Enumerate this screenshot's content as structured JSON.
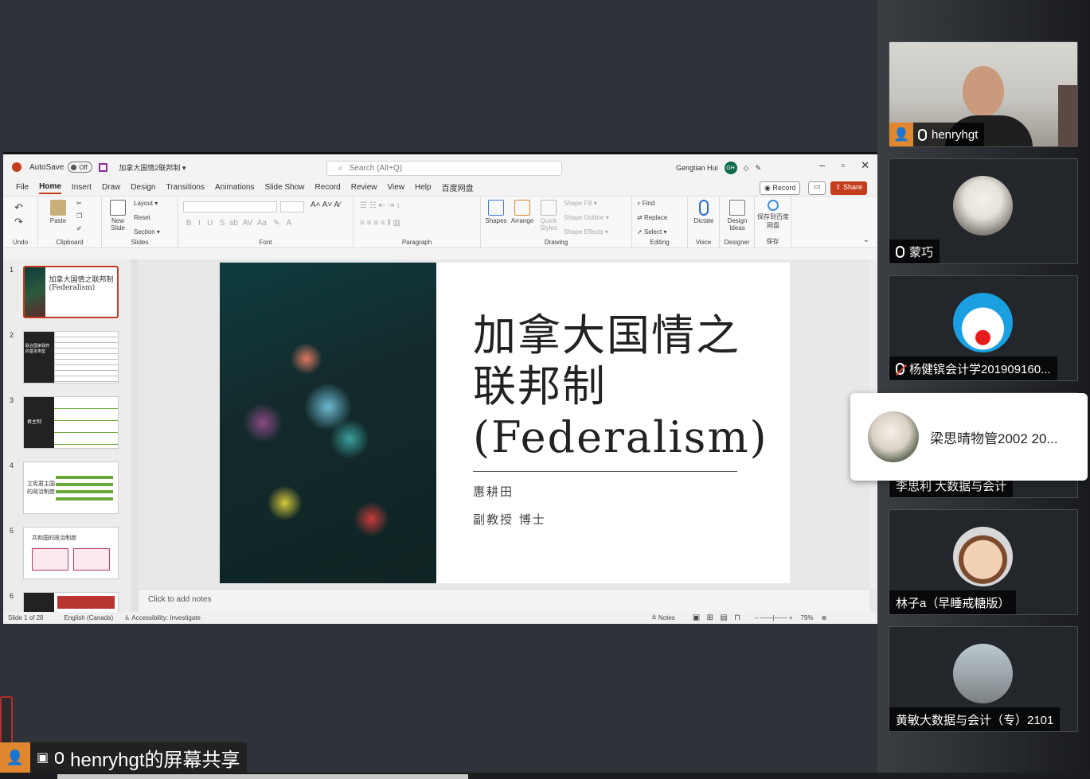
{
  "ppt": {
    "autosave_label": "AutoSave",
    "toggle_label": "Off",
    "doc_title": "加拿大国情2联邦制 ▾",
    "search_placeholder": "Search (Alt+Q)",
    "user_name": "Gengtian Hui",
    "user_initials": "GH",
    "menu": [
      "File",
      "Home",
      "Insert",
      "Draw",
      "Design",
      "Transitions",
      "Animations",
      "Slide Show",
      "Record",
      "Review",
      "View",
      "Help",
      "百度网盘"
    ],
    "record_label": "Record",
    "share_label": "Share",
    "ribbon": {
      "undo_group": "Undo",
      "clipboard_group": "Clipboard",
      "paste": "Paste",
      "slides_group": "Slides",
      "new_slide": "New Slide",
      "layout": "Layout ▾",
      "reset": "Reset",
      "section": "Section ▾",
      "font_group": "Font",
      "paragraph_group": "Paragraph",
      "drawing_group": "Drawing",
      "shapes": "Shapes",
      "arrange": "Arrange",
      "quick_styles": "Quick Styles",
      "shape_fill": "Shape Fill ▾",
      "shape_outline": "Shape Outline ▾",
      "shape_effects": "Shape Effects ▾",
      "editing_group": "Editing",
      "find": "Find",
      "replace": "Replace",
      "select": "Select ▾",
      "voice_group": "Voice",
      "dictate": "Dictate",
      "designer_group": "Designer",
      "design_ideas": "Design Ideas",
      "save_group": "保存",
      "save_baidu": "保存到百度网盘"
    },
    "thumbs": [
      {
        "num": "1",
        "text": "加拿大国情之联邦制 (Federalism)"
      },
      {
        "num": "2",
        "text": "联合国家政府的基本类型"
      },
      {
        "num": "3",
        "text": "君主制"
      },
      {
        "num": "4",
        "text": "立宪君主国的政治制度"
      },
      {
        "num": "5",
        "text": "共和国的政治制度"
      },
      {
        "num": "6",
        "text": ""
      }
    ],
    "slide": {
      "title": "加拿大国情之联邦制 (Federalism)",
      "author": "惠耕田",
      "position": "副教授 博士"
    },
    "notes_placeholder": "Click to add notes",
    "status": {
      "slide_of": "Slide 1 of 28",
      "language": "English (Canada)",
      "accessibility": "Accessibility: Investigate",
      "notes": "Notes",
      "zoom": "79%"
    }
  },
  "participants": [
    {
      "name": "henryhgt",
      "muted": false
    },
    {
      "name": "蒙巧",
      "muted": false
    },
    {
      "name": "杨健镔会计学201909160...",
      "muted": true
    },
    {
      "name": "李思利 大数据与会计",
      "muted": false
    },
    {
      "name": "林子a（早睡戒糖版）",
      "muted": false
    },
    {
      "name": "黄敏大数据与会计（专）2101",
      "muted": false
    }
  ],
  "popup_name": "梁思晴物管2002 20...",
  "share_label": "henryhgt的屏幕共享",
  "colors": {
    "ppt_accent": "#c43e1c",
    "cam_bg": "#2f3238"
  }
}
